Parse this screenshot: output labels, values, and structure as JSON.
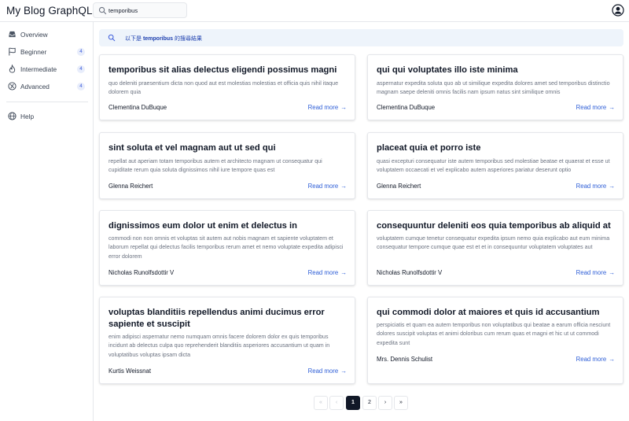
{
  "header": {
    "app_title": "My Blog GraphQL",
    "search_value": "temporibus"
  },
  "sidebar": {
    "items": [
      {
        "label": "Overview",
        "icon": "inbox-icon"
      },
      {
        "label": "Beginner",
        "icon": "flag-icon",
        "badge": "4"
      },
      {
        "label": "Intermediate",
        "icon": "flame-icon",
        "badge": "4"
      },
      {
        "label": "Advanced",
        "icon": "compass-icon",
        "badge": "4"
      },
      {
        "label": "Help",
        "icon": "globe-icon"
      }
    ]
  },
  "banner": {
    "prefix": "以下是 ",
    "query": "temporibus",
    "suffix": " 的搜尋結果"
  },
  "posts": [
    {
      "title": "temporibus sit alias delectus eligendi possimus magni",
      "excerpt": "quo deleniti praesentium dicta non quod aut est molestias molestias et officia quis nihil itaque dolorem quia",
      "author": "Clementina DuBuque",
      "read_more": "Read more"
    },
    {
      "title": "qui qui voluptates illo iste minima",
      "excerpt": "aspernatur expedita soluta quo ab ut similique expedita dolores amet sed temporibus distinctio magnam saepe deleniti omnis facilis nam ipsum natus sint similique omnis",
      "author": "Clementina DuBuque",
      "read_more": "Read more"
    },
    {
      "title": "sint soluta et vel magnam aut ut sed qui",
      "excerpt": "repellat aut aperiam totam temporibus autem et architecto magnam ut consequatur qui cupiditate rerum quia soluta dignissimos nihil iure tempore quas est",
      "author": "Glenna Reichert",
      "read_more": "Read more"
    },
    {
      "title": "placeat quia et porro iste",
      "excerpt": "quasi excepturi consequatur iste autem temporibus sed molestiae beatae et quaerat et esse ut voluptatem occaecati et vel explicabo autem asperiores pariatur deserunt optio",
      "author": "Glenna Reichert",
      "read_more": "Read more"
    },
    {
      "title": "dignissimos eum dolor ut enim et delectus in",
      "excerpt": "commodi non non omnis et voluptas sit autem aut nobis magnam et sapiente voluptatem et laborum repellat qui delectus facilis temporibus rerum amet et nemo voluptate expedita adipisci error dolorem",
      "author": "Nicholas Runolfsdottir V",
      "read_more": "Read more"
    },
    {
      "title": "consequuntur deleniti eos quia temporibus ab aliquid at",
      "excerpt": "voluptatem cumque tenetur consequatur expedita ipsum nemo quia explicabo aut eum minima consequatur tempore cumque quae est et et in consequuntur voluptatem voluptates aut",
      "author": "Nicholas Runolfsdottir V",
      "read_more": "Read more"
    },
    {
      "title": "voluptas blanditiis repellendus animi ducimus error sapiente et suscipit",
      "excerpt": "enim adipisci aspernatur nemo numquam omnis facere dolorem dolor ex quis temporibus incidunt ab delectus culpa quo reprehenderit blanditiis asperiores accusantium ut quam in voluptatibus voluptas ipsam dicta",
      "author": "Kurtis Weissnat",
      "read_more": "Read more"
    },
    {
      "title": "qui commodi dolor at maiores et quis id accusantium",
      "excerpt": "perspiciatis et quam ea autem temporibus non voluptatibus qui beatae a earum officia nesciunt dolores suscipit voluptas et animi doloribus cum rerum quas et magni et hic ut ut commodi expedita sunt",
      "author": "Mrs. Dennis Schulist",
      "read_more": "Read more"
    }
  ],
  "pagination": {
    "first": "«",
    "prev": "‹",
    "pages": [
      "1",
      "2"
    ],
    "current": "1",
    "next": "›",
    "last": "»"
  },
  "colors": {
    "accent": "#2f5fd7",
    "banner_bg": "#eef4fb",
    "active_page": "#111827"
  }
}
